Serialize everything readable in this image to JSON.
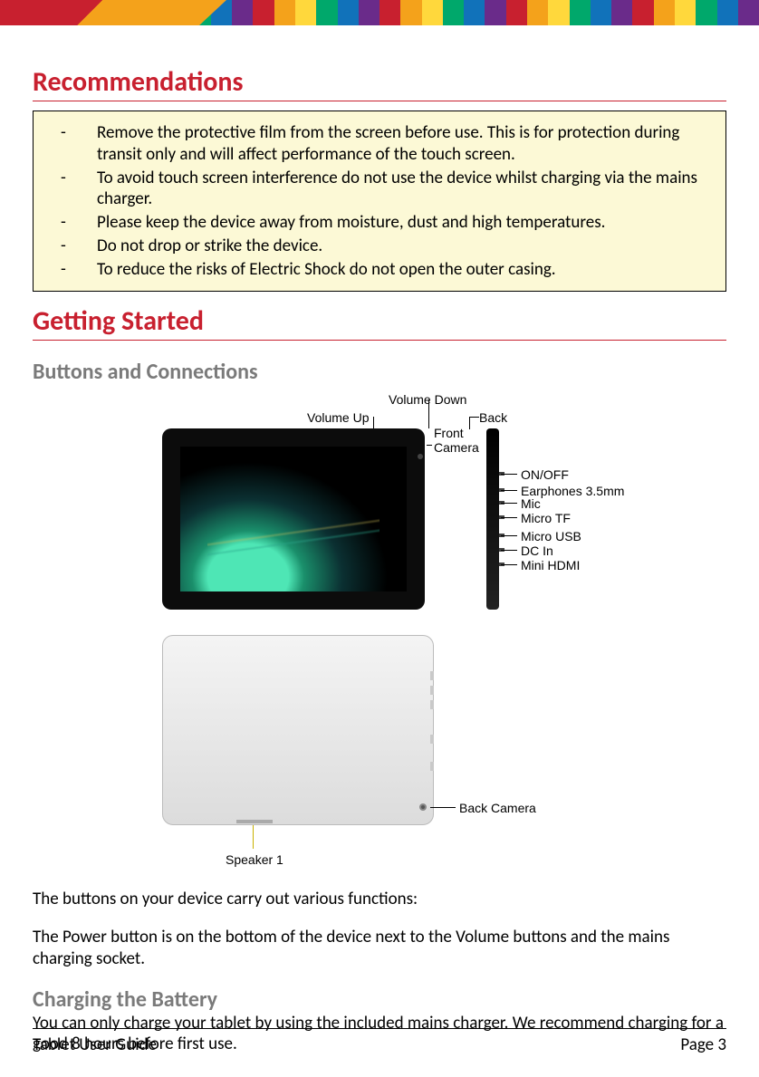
{
  "headings": {
    "recommendations": "Recommendations",
    "getting_started": "Getting Started",
    "buttons_connections": "Buttons and Connections",
    "charging": "Charging the Battery"
  },
  "recommendations": [
    "Remove the protective film from the screen before use. This is for protection during transit only and will affect performance of the touch screen.",
    "To avoid touch screen interference do not use the device whilst charging via the mains charger.",
    "Please keep the device away from moisture, dust and high temperatures.",
    "Do not drop or strike the device.",
    "To reduce the risks of Electric Shock do not open the outer casing."
  ],
  "diagram_labels": {
    "volume_up": "Volume Up",
    "volume_down": "Volume Down",
    "back": "Back",
    "front_camera": "Front\nCamera",
    "on_off": "ON/OFF",
    "earphones": "Earphones 3.5mm",
    "mic": "Mic",
    "micro_tf": "Micro TF",
    "micro_usb": "Micro USB",
    "dc_in": "DC In",
    "mini_hdmi": "Mini HDMI",
    "back_camera": "Back Camera",
    "speaker1": "Speaker 1"
  },
  "body": {
    "buttons_intro": "The buttons on your device carry out various functions:",
    "power_button": "The Power button is on the bottom of the device next to the Volume buttons and the mains charging socket.",
    "charging": "You can only charge your tablet by using the included mains charger. We recommend charging for a good 8 hours before first use."
  },
  "footer": {
    "title": "Tablet User Guide",
    "page": "Page 3"
  },
  "topbar_colors": [
    "#c8202f",
    "#f4a21b",
    "#ffd83c",
    "#00a86b",
    "#1172ba",
    "#6a2b8a",
    "#c8202f",
    "#f4a21b",
    "#ffd83c",
    "#00a86b",
    "#1172ba",
    "#6a2b8a",
    "#c8202f",
    "#f4a21b",
    "#ffd83c",
    "#00a86b",
    "#1172ba",
    "#6a2b8a",
    "#c8202f",
    "#f4a21b",
    "#ffd83c",
    "#00a86b",
    "#1172ba",
    "#6a2b8a",
    "#c8202f",
    "#f4a21b",
    "#ffd83c",
    "#00a86b",
    "#1172ba",
    "#6a2b8a",
    "#c8202f",
    "#f4a21b",
    "#ffd83c",
    "#00a86b",
    "#1172ba",
    "#6a2b8a"
  ]
}
